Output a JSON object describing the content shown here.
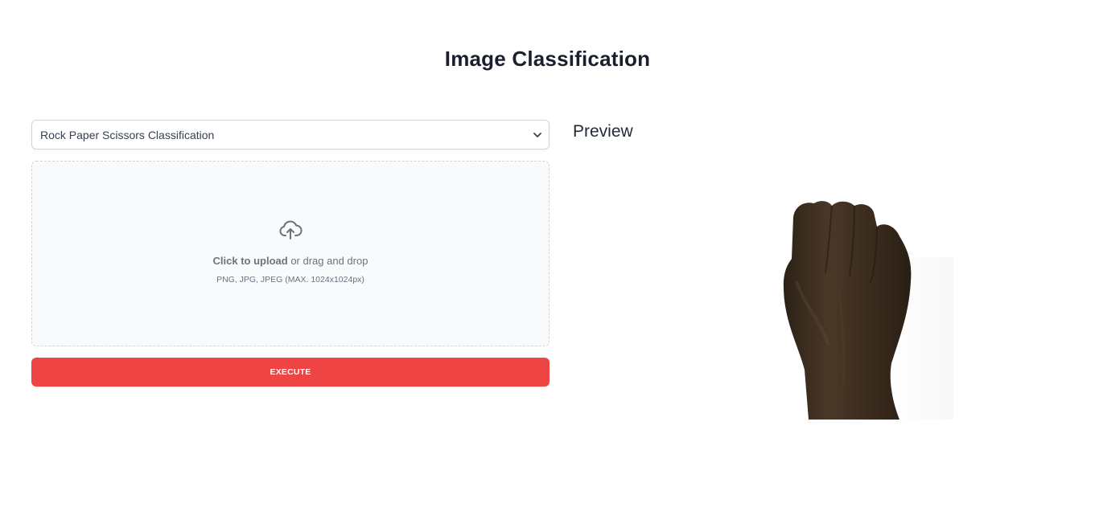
{
  "page": {
    "title": "Image Classification"
  },
  "model_select": {
    "selected": "Rock Paper Scissors Classification"
  },
  "upload": {
    "click_text": "Click to upload",
    "drag_text": " or drag and drop",
    "hint": "PNG, JPG, JPEG (MAX. 1024x1024px)",
    "icon": "cloud-upload-icon"
  },
  "actions": {
    "execute_label": "EXECUTE"
  },
  "preview": {
    "heading": "Preview",
    "image": "rock-hand-fist"
  },
  "colors": {
    "accent": "#ef4444",
    "dropzone_bg": "#f9fafb",
    "border": "#d1d5db",
    "text_muted": "#6b7280"
  }
}
